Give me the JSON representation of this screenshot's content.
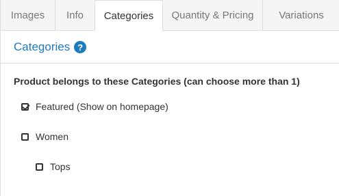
{
  "tabs": [
    {
      "label": "Images",
      "active": false
    },
    {
      "label": "Info",
      "active": false
    },
    {
      "label": "Categories",
      "active": true
    },
    {
      "label": "Quantity & Pricing",
      "active": false
    },
    {
      "label": "Variations",
      "active": false
    }
  ],
  "panel": {
    "title": "Categories",
    "help_icon": "?"
  },
  "categories": {
    "label": "Product belongs to these Categories (can choose more than 1)",
    "items": [
      {
        "label": "Featured (Show on homepage)",
        "checked": true,
        "level": 0
      },
      {
        "label": "Women",
        "checked": false,
        "level": 0
      },
      {
        "label": "Tops",
        "checked": false,
        "level": 1
      }
    ]
  },
  "colors": {
    "accent": "#1f7bbf",
    "tab_bg": "#f5f5f5",
    "border": "#dddddd"
  }
}
